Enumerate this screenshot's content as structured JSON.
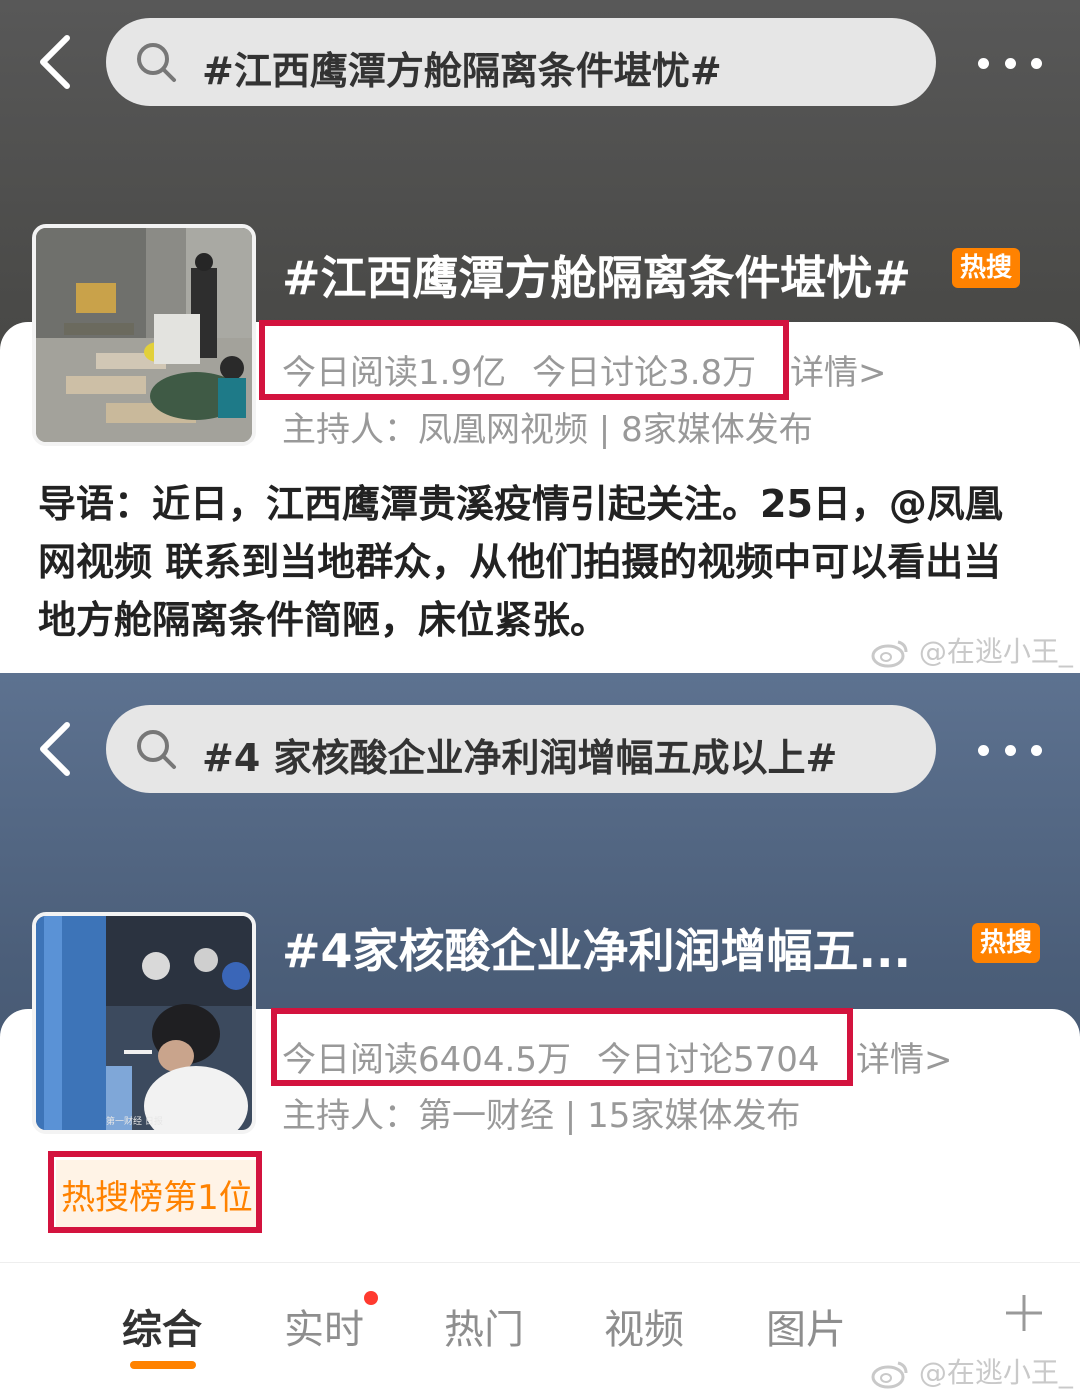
{
  "screen1": {
    "search_query": "#江西鹰潭方舱隔离条件堪忧#",
    "topic_title": "#江西鹰潭方舱隔离条件堪忧#",
    "hot_badge": "热搜",
    "read_today": "今日阅读1.9亿",
    "discuss_today": "今日讨论3.8万",
    "detail_link": "详情>",
    "host": "主持人：凤凰网视频 | 8家媒体发布",
    "intro": "导语：近日，江西鹰潭贵溪疫情引起关注。25日，@凤凰网视频 联系到当地群众，从他们拍摄的视频中可以看出当地方舱隔离条件简陋，床位紧张。",
    "watermark": "@在逃小王_"
  },
  "screen2": {
    "search_query": "#4 家核酸企业净利润增幅五成以上#",
    "topic_title": "#4家核酸企业净利润增幅五...",
    "hot_badge": "热搜",
    "read_today": "今日阅读6404.5万",
    "discuss_today": "今日讨论5704",
    "detail_link": "详情>",
    "host": "主持人：第一财经 | 15家媒体发布",
    "rank_badge": "热搜榜第1位",
    "thumb_caption": "第一财经 日报",
    "watermark": "@在逃小王_"
  },
  "tabs": [
    "综合",
    "实时",
    "热门",
    "视频",
    "图片"
  ],
  "active_tab": "综合",
  "colors": {
    "accent": "#ff8200",
    "highlight_border": "#d3133e",
    "secondary_text": "#999999"
  }
}
